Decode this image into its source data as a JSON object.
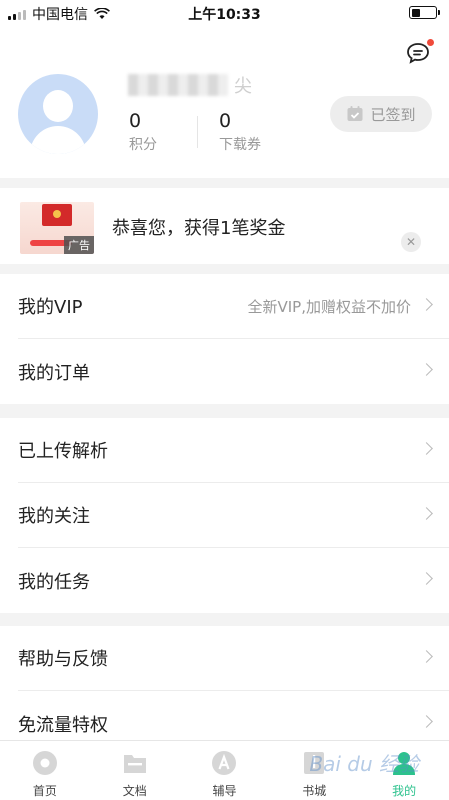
{
  "status_bar": {
    "carrier": "中国电信",
    "time": "上午10:33"
  },
  "profile": {
    "username_suffix": "尖",
    "points_value": "0",
    "points_label": "积分",
    "coupons_value": "0",
    "coupons_label": "下载券",
    "signin_label": "已签到"
  },
  "ad": {
    "text": "恭喜您，获得1笔奖金",
    "tag": "广告"
  },
  "menu": {
    "group1": [
      {
        "label": "我的VIP",
        "extra": "全新VIP,加赠权益不加价"
      },
      {
        "label": "我的订单",
        "extra": ""
      }
    ],
    "group2": [
      {
        "label": "已上传解析"
      },
      {
        "label": "我的关注"
      },
      {
        "label": "我的任务"
      }
    ],
    "group3": [
      {
        "label": "帮助与反馈"
      },
      {
        "label": "免流量特权"
      }
    ]
  },
  "tabs": [
    {
      "label": "首页",
      "icon": "home-icon",
      "active": false
    },
    {
      "label": "文档",
      "icon": "folder-icon",
      "active": false
    },
    {
      "label": "辅导",
      "icon": "tutor-icon",
      "active": false
    },
    {
      "label": "书城",
      "icon": "book-icon",
      "active": false
    },
    {
      "label": "我的",
      "icon": "profile-icon",
      "active": true
    }
  ],
  "watermark": "Bai du 经验",
  "colors": {
    "accent": "#2cc28d",
    "notification_dot": "#f04a3b",
    "avatar_bg": "#c9dcf7"
  }
}
